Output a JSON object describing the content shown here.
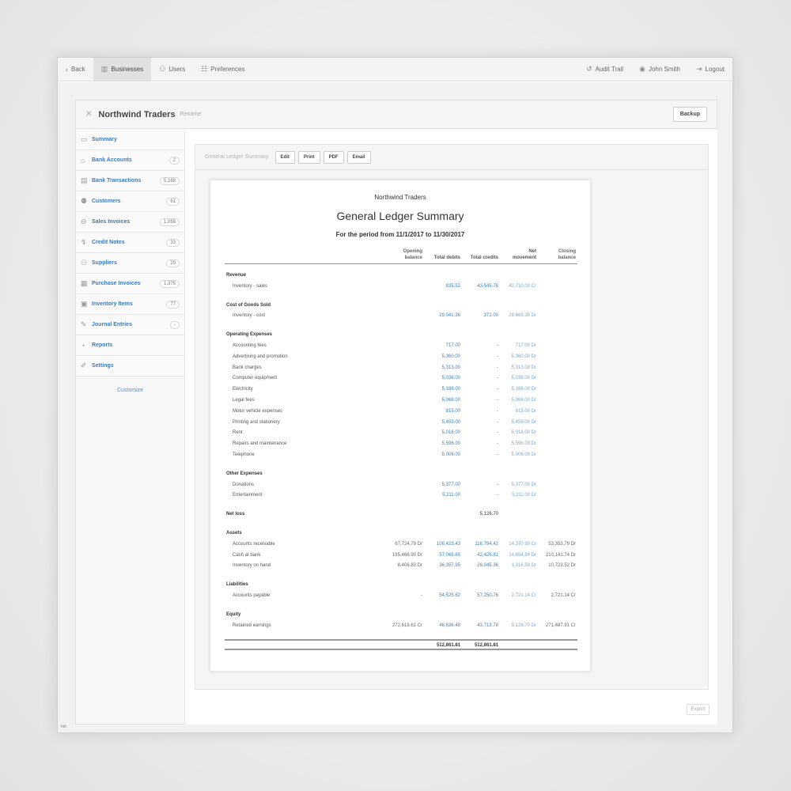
{
  "nav": {
    "left": [
      {
        "name": "back",
        "label": "Back",
        "icon": "‹"
      },
      {
        "name": "businesses",
        "label": "Businesses",
        "icon": "▥"
      },
      {
        "name": "users",
        "label": "Users",
        "icon": "⚇"
      },
      {
        "name": "preferences",
        "label": "Preferences",
        "icon": "☷"
      }
    ],
    "right": [
      {
        "name": "audit-trail",
        "label": "Audit Trail",
        "icon": "↺"
      },
      {
        "name": "user",
        "label": "John Smith",
        "icon": "◉"
      },
      {
        "name": "logout",
        "label": "Logout",
        "icon": "⇥"
      }
    ]
  },
  "business": {
    "name": "Northwind Traders",
    "rename": "Rename",
    "backup": "Backup"
  },
  "sidebar": {
    "items": [
      {
        "icon": "▭",
        "label": "Summary",
        "count": ""
      },
      {
        "icon": "⌂",
        "label": "Bank Accounts",
        "count": "2"
      },
      {
        "icon": "▤",
        "label": "Bank Transactions",
        "count": "5,168"
      },
      {
        "icon": "⚉",
        "label": "Customers",
        "count": "61"
      },
      {
        "icon": "⊖",
        "label": "Sales Invoices",
        "count": "1,058"
      },
      {
        "icon": "↯",
        "label": "Credit Notes",
        "count": "33"
      },
      {
        "icon": "⚇",
        "label": "Suppliers",
        "count": "29"
      },
      {
        "icon": "▦",
        "label": "Purchase Invoices",
        "count": "1,375"
      },
      {
        "icon": "▣",
        "label": "Inventory Items",
        "count": "77"
      },
      {
        "icon": "✎",
        "label": "Journal Entries",
        "count": "-"
      },
      {
        "icon": "◔",
        "label": "Reports",
        "count": ""
      },
      {
        "icon": "✐",
        "label": "Settings",
        "count": ""
      }
    ],
    "customize": "Customize"
  },
  "report_bar": {
    "title": "General Ledger Summary",
    "edit": "Edit",
    "print": "Print",
    "pdf": "PDF",
    "email": "Email",
    "export": "Export"
  },
  "report": {
    "org": "Northwind Traders",
    "title": "General Ledger Summary",
    "period": "For the period from 11/1/2017 to 11/30/2017",
    "columns": [
      {
        "line1": "Opening",
        "line2": "balance"
      },
      {
        "line1": "",
        "line2": "Total debits"
      },
      {
        "line1": "",
        "line2": "Total credits"
      },
      {
        "line1": "Net",
        "line2": "movement"
      },
      {
        "line1": "Closing",
        "line2": "balance"
      }
    ],
    "rows": [
      {
        "type": "section",
        "label": "Revenue"
      },
      {
        "type": "line",
        "label": "Inventory - sales",
        "v": [
          "",
          "835.52",
          "43,545.78",
          "42,710.00 Cr",
          ""
        ]
      },
      {
        "type": "gap"
      },
      {
        "type": "section",
        "label": "Cost of Goods Sold"
      },
      {
        "type": "line",
        "label": "Inventory - cost",
        "v": [
          "",
          "29,041.36",
          "372.00",
          "28,669.36 Dr",
          ""
        ]
      },
      {
        "type": "gap"
      },
      {
        "type": "section",
        "label": "Operating Expenses"
      },
      {
        "type": "line",
        "label": "Accounting fees",
        "v": [
          "",
          "717.00",
          "-",
          "717.00 Dr",
          ""
        ]
      },
      {
        "type": "line",
        "label": "Advertising and promotion",
        "v": [
          "",
          "5,360.00",
          "-",
          "5,360.00 Dr",
          ""
        ]
      },
      {
        "type": "line",
        "label": "Bank charges",
        "v": [
          "",
          "5,313.00",
          "-",
          "5,313.00 Dr",
          ""
        ]
      },
      {
        "type": "line",
        "label": "Computer equipment",
        "v": [
          "",
          "5,036.00",
          "-",
          "5,036.00 Dr",
          ""
        ]
      },
      {
        "type": "line",
        "label": "Electricity",
        "v": [
          "",
          "5,186.00",
          "-",
          "5,186.00 Dr",
          ""
        ]
      },
      {
        "type": "line",
        "label": "Legal fees",
        "v": [
          "",
          "5,066.00",
          "-",
          "5,066.00 Dr",
          ""
        ]
      },
      {
        "type": "line",
        "label": "Motor vehicle expenses",
        "v": [
          "",
          "815.00",
          "-",
          "815.00 Dr",
          ""
        ]
      },
      {
        "type": "line",
        "label": "Printing and stationery",
        "v": [
          "",
          "5,459.00",
          "-",
          "5,459.00 Dr",
          ""
        ]
      },
      {
        "type": "line",
        "label": "Rent",
        "v": [
          "",
          "5,016.00",
          "-",
          "5,016.00 Dr",
          ""
        ]
      },
      {
        "type": "line",
        "label": "Repairs and maintenance",
        "v": [
          "",
          "5,596.00",
          "-",
          "5,596.00 Dr",
          ""
        ]
      },
      {
        "type": "line",
        "label": "Telephone",
        "v": [
          "",
          "5,006.00",
          "-",
          "5,006.00 Dr",
          ""
        ]
      },
      {
        "type": "gap"
      },
      {
        "type": "section",
        "label": "Other Expenses"
      },
      {
        "type": "line",
        "label": "Donations",
        "v": [
          "",
          "5,377.00",
          "-",
          "5,377.00 Dr",
          ""
        ]
      },
      {
        "type": "line",
        "label": "Entertainment",
        "v": [
          "",
          "5,211.00",
          "-",
          "5,211.00 Dr",
          ""
        ]
      },
      {
        "type": "gap"
      },
      {
        "type": "netloss",
        "label": "Net loss",
        "v": [
          "",
          "",
          "5,126.70",
          "",
          ""
        ]
      },
      {
        "type": "gap"
      },
      {
        "type": "section",
        "label": "Assets"
      },
      {
        "type": "line",
        "label": "Accounts receivable",
        "v": [
          "67,724.79 Dr",
          "106,423.43",
          "116,794.42",
          "14,370.99 Cr",
          "53,353.79 Dr"
        ]
      },
      {
        "type": "line",
        "label": "Cash at bank",
        "v": [
          "195,466.90 Dr",
          "57,065.65",
          "42,426.81",
          "14,654.84 Dr",
          "210,141.74 Dr"
        ]
      },
      {
        "type": "line",
        "label": "Inventory on hand",
        "v": [
          "8,406.83 Dr",
          "36,357.95",
          "26,045.36",
          "1,316.59 Dr",
          "10,723.52 Dr"
        ]
      },
      {
        "type": "gap"
      },
      {
        "type": "section",
        "label": "Liabilities"
      },
      {
        "type": "line",
        "label": "Accounts payable",
        "v": [
          "-",
          "54,525.62",
          "57,250.76",
          "2,721.14 Cr",
          "2,721.14 Cr"
        ]
      },
      {
        "type": "gap"
      },
      {
        "type": "section",
        "label": "Equity"
      },
      {
        "type": "line",
        "label": "Retained earnings",
        "v": [
          "272,618.61 Cr",
          "46,636.48",
          "43,713.78",
          "5,126.70 Dr",
          "271,487.91 Cr"
        ]
      },
      {
        "type": "gap"
      },
      {
        "type": "total",
        "label": "",
        "v": [
          "",
          "512,861.81",
          "512,861.81",
          "",
          ""
        ]
      }
    ]
  },
  "footer_mark": "Intl"
}
